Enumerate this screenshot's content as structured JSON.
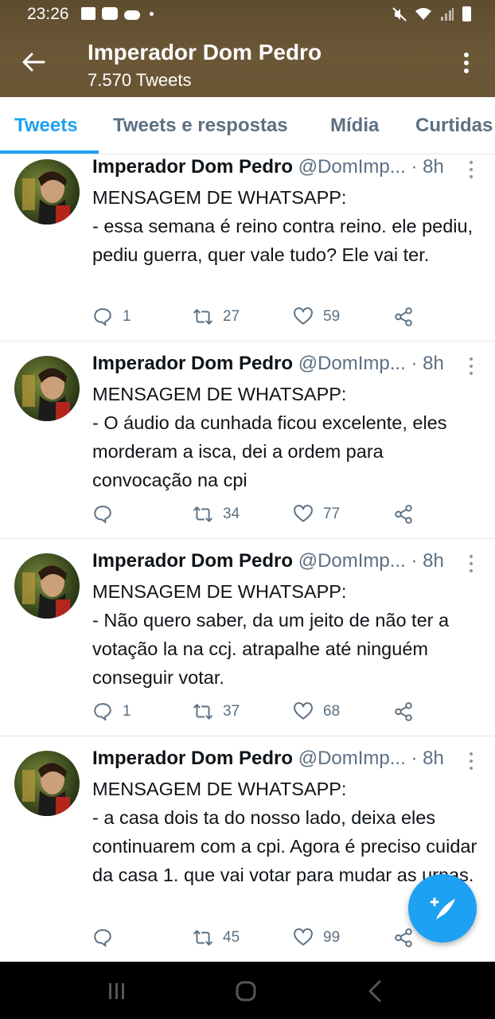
{
  "status_bar": {
    "time": "23:26",
    "left_icons": [
      "gallery-icon",
      "youtube-icon",
      "cloud-icon",
      "dot-icon"
    ],
    "right_icons": [
      "mute-icon",
      "wifi-icon",
      "signal-icon",
      "battery-icon"
    ]
  },
  "header": {
    "title": "Imperador Dom Pedro",
    "subtitle": "7.570 Tweets",
    "background_color": "#6b5736"
  },
  "tabs": [
    {
      "label": "Tweets",
      "active": true
    },
    {
      "label": "Tweets e respostas",
      "active": false
    },
    {
      "label": "Mídia",
      "active": false
    },
    {
      "label": "Curtidas",
      "active": false
    }
  ],
  "accent_color": "#1da1f2",
  "tweets": [
    {
      "name": "Imperador Dom Pedro",
      "handle": "@DomImp...",
      "time": "· 8h",
      "text": "MENSAGEM DE WHATSAPP:\n- essa semana é reino contra reino. ele pediu, pediu guerra, quer vale tudo? Ele vai ter.",
      "replies": "1",
      "retweets": "27",
      "likes": "59"
    },
    {
      "name": "Imperador Dom Pedro",
      "handle": "@DomImp...",
      "time": "· 8h",
      "text": "MENSAGEM DE WHATSAPP:\n- O áudio da cunhada ficou excelente, eles morderam a isca, dei a ordem para convocação na cpi",
      "replies": "",
      "retweets": "34",
      "likes": "77"
    },
    {
      "name": "Imperador Dom Pedro",
      "handle": "@DomImp...",
      "time": "· 8h",
      "text": "MENSAGEM DE WHATSAPP:\n- Não quero saber, da um jeito de não ter a votação la na ccj. atrapalhe até ninguém conseguir votar.",
      "replies": "1",
      "retweets": "37",
      "likes": "68"
    },
    {
      "name": "Imperador Dom Pedro",
      "handle": "@DomImp...",
      "time": "· 8h",
      "text": "MENSAGEM DE WHATSAPP:\n-  a casa dois ta do nosso lado, deixa eles continuarem com a cpi. Agora é preciso cuidar da casa 1. que vai votar para mudar as urnas.",
      "replies": "",
      "retweets": "45",
      "likes": "99"
    }
  ],
  "fab_icon": "compose-tweet-icon",
  "nav_icons": [
    "recents-icon",
    "home-icon",
    "back-icon"
  ]
}
